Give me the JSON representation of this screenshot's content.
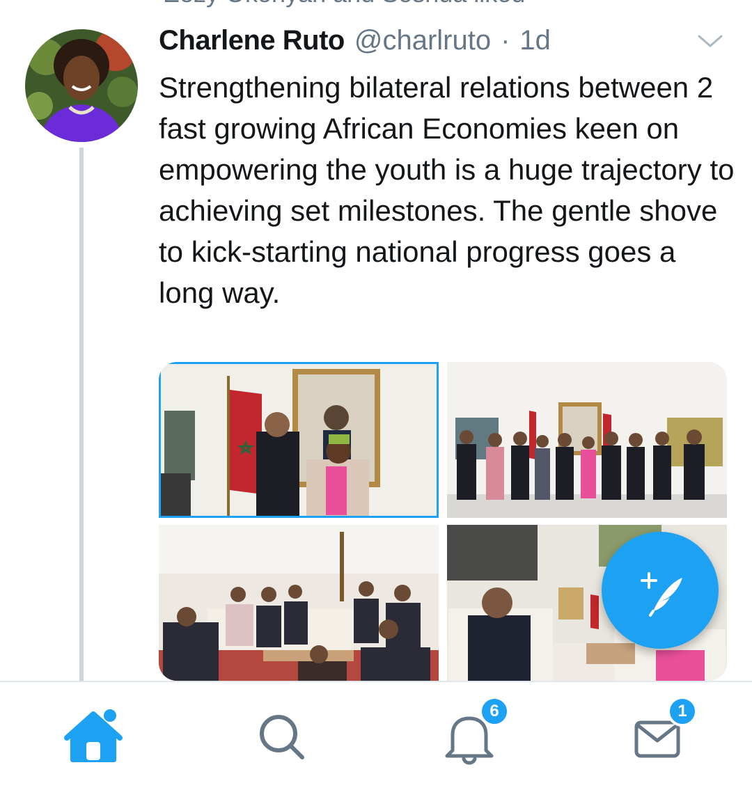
{
  "social_context": {
    "text": "Eezy Okonyan and Soshua liked",
    "icon": "heart-icon"
  },
  "tweet": {
    "display_name": "Charlene Ruto",
    "handle": "@charlruto",
    "separator": "·",
    "time": "1d",
    "text": "Strengthening bilateral relations between 2 fast growing African Economies keen on empowering the youth is a huge trajectory to achieving set milestones. The gentle shove to kick-starting national progress goes a long way.",
    "media_count": 4
  },
  "nav": {
    "items": [
      {
        "name": "home",
        "icon": "home-icon",
        "active": true,
        "has_new_dot": true
      },
      {
        "name": "search",
        "icon": "search-icon",
        "active": false
      },
      {
        "name": "notifications",
        "icon": "bell-icon",
        "badge": "6"
      },
      {
        "name": "messages",
        "icon": "envelope-icon",
        "badge": "1"
      }
    ]
  },
  "colors": {
    "accent": "#1da1f2",
    "text": "#14171a",
    "secondary": "#657786",
    "divider": "#e1e8ed"
  }
}
